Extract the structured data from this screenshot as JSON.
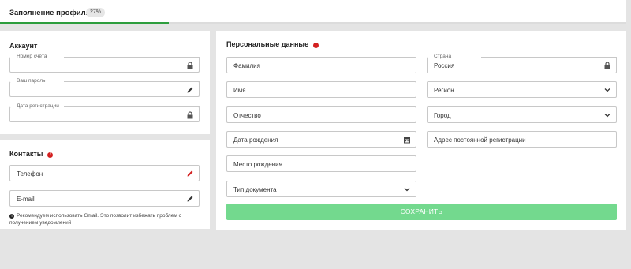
{
  "header": {
    "title": "Заполнение профиля",
    "progress_label": "27%",
    "progress_fraction": 0.27
  },
  "account": {
    "title": "Аккаунт",
    "account_number_label": "Номер счёта",
    "password_label": "Ваш пароль",
    "registration_date_label": "Дата регистрации"
  },
  "contacts": {
    "title": "Контакты",
    "phone_placeholder": "Телефон",
    "email_placeholder": "E-mail",
    "note": "Рекомендуем использовать Gmail. Это позволит избежать проблем с получением уведомлений"
  },
  "personal": {
    "title": "Персональные данные",
    "surname_placeholder": "Фамилия",
    "name_placeholder": "Имя",
    "patronymic_placeholder": "Отчество",
    "birthdate_placeholder": "Дата рождения",
    "birthplace_placeholder": "Место рождения",
    "document_type_placeholder": "Тип документа",
    "country_label": "Страна",
    "country_value": "Россия",
    "region_placeholder": "Регион",
    "city_placeholder": "Город",
    "address_placeholder": "Адрес постоянной регистрации",
    "save_label": "СОХРАНИТЬ"
  },
  "icons": {
    "lock": "lock-icon",
    "pencil": "pencil-icon",
    "calendar": "calendar-icon",
    "chevron": "chevron-down-icon",
    "info": "info-icon"
  },
  "colors": {
    "progress": "#2e9e3e",
    "save_button": "#73d98e",
    "alert": "#d32020"
  }
}
